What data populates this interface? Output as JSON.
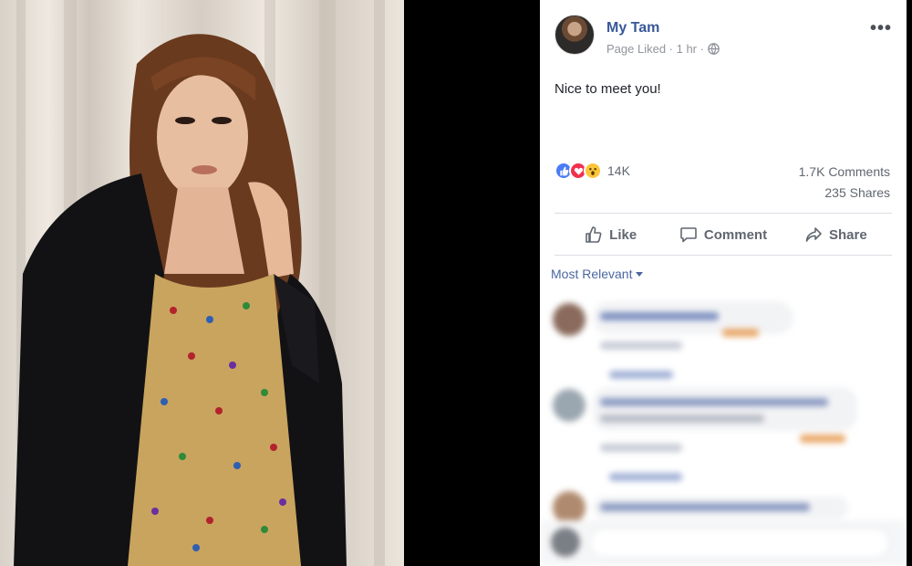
{
  "post": {
    "author": "My Tam",
    "meta_text": "Page Liked · 1 hr ·",
    "text": "Nice to meet you!",
    "reaction_count": "14K",
    "comments_count": "1.7K Comments",
    "shares_count": "235 Shares",
    "reactions": [
      "like-icon",
      "love-icon",
      "wow-icon"
    ]
  },
  "actions": {
    "like": "Like",
    "comment": "Comment",
    "share": "Share"
  },
  "comments_section": {
    "sort_label": "Most Relevant"
  },
  "colors": {
    "author": "#385898",
    "sort": "#4b67a1",
    "action_text": "#606770",
    "like_reaction": "#4a7cf6",
    "love_reaction": "#f0314e",
    "wow_reaction": "#fcc63a"
  }
}
